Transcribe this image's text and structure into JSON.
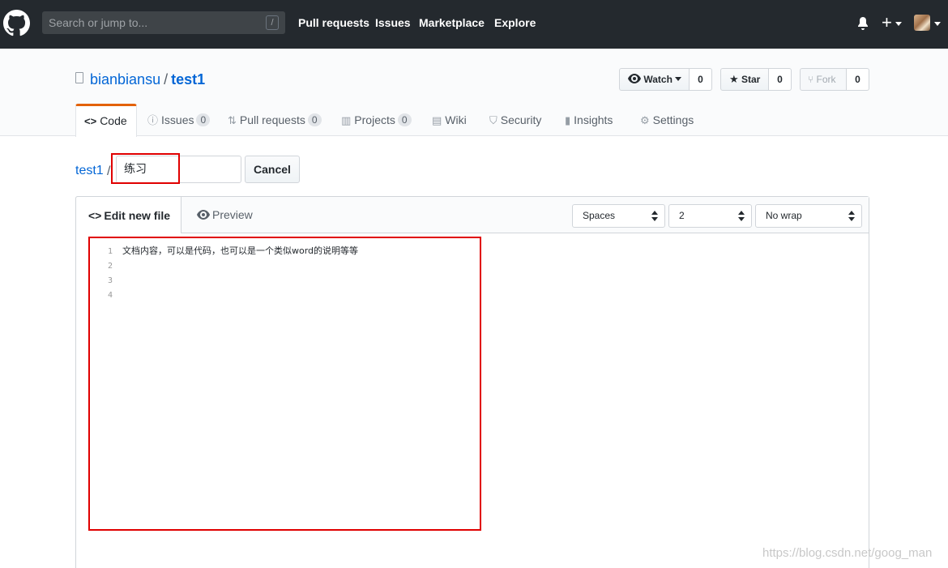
{
  "header": {
    "search_placeholder": "Search or jump to...",
    "search_shortcut": "/",
    "nav": [
      "Pull requests",
      "Issues",
      "Marketplace",
      "Explore"
    ]
  },
  "repo": {
    "owner": "bianbiansu",
    "separator": "/",
    "name": "test1",
    "watch": {
      "label": "Watch",
      "count": "0"
    },
    "star": {
      "label": "Star",
      "count": "0"
    },
    "fork": {
      "label": "Fork",
      "count": "0"
    }
  },
  "tabs": {
    "code": "Code",
    "issues": {
      "label": "Issues",
      "count": "0"
    },
    "pulls": {
      "label": "Pull requests",
      "count": "0"
    },
    "projects": {
      "label": "Projects",
      "count": "0"
    },
    "wiki": "Wiki",
    "security": "Security",
    "insights": "Insights",
    "settings": "Settings"
  },
  "breadcrumb": {
    "repo": "test1",
    "separator": "/",
    "filename_value": "练习",
    "cancel": "Cancel"
  },
  "editor": {
    "edit_tab": "Edit new file",
    "preview_tab": "Preview",
    "indent_mode": "Spaces",
    "indent_size": "2",
    "wrap_mode": "No wrap",
    "line_numbers": [
      "1",
      "2",
      "3",
      "4"
    ],
    "line1": "文档内容，可以是代码，也可以是一个类似word的说明等等"
  },
  "watermark": "https://blog.csdn.net/goog_man",
  "colors": {
    "header_bg": "#24292e",
    "link": "#0366d6",
    "active_tab_accent": "#e36209",
    "highlight_box": "#e00000"
  }
}
